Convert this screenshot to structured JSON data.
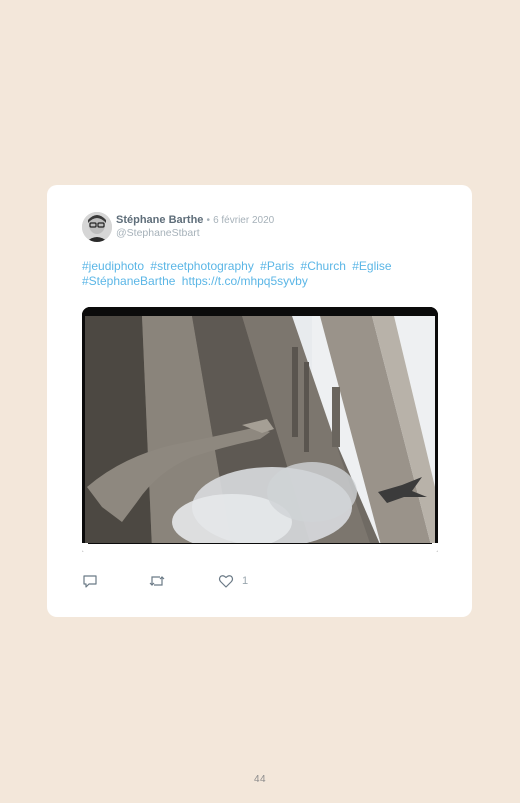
{
  "tweet": {
    "author_name": "Stéphane Barthe",
    "separator": "•",
    "date": "6 février 2020",
    "handle": "@StephaneStbart",
    "text_parts": [
      "#jeudiphoto",
      "#streetphotography",
      "#Paris",
      "#Church",
      "#Eglise",
      "#StéphaneBarthe",
      "https://t.co/mhpq5syvby"
    ],
    "likes": "1",
    "icons": {
      "reply": "reply-icon",
      "retweet": "retweet-icon",
      "like": "heart-icon"
    }
  },
  "page": {
    "number": "44"
  },
  "colors": {
    "background": "#f3e7da",
    "card": "#ffffff",
    "link": "#5bb6e6",
    "muted": "#a6b1b9"
  }
}
